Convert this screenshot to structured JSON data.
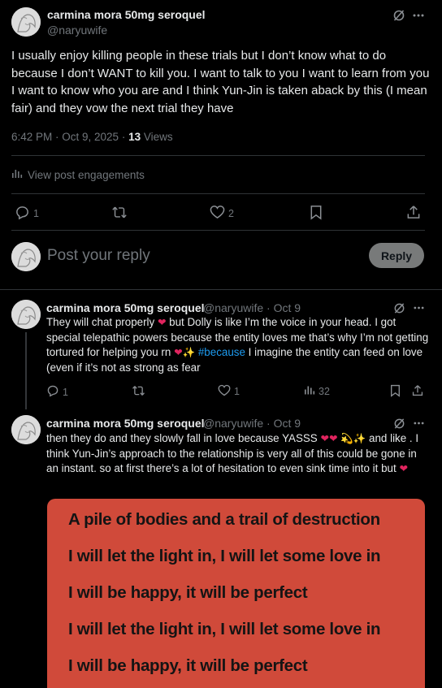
{
  "main_post": {
    "author_name": "carmina mora 50mg seroquel",
    "author_handle": "@naryuwife",
    "text": "I usually enjoy killing people in these trials but I don’t know what to do because I don’t WANT to kill you. I want to talk to you I want to learn from you I want to know who you are and I think Yun-Jin is taken aback by this (I mean fair) and they vow the next trial they have",
    "timestamp": "6:42 PM · Oct 9, 2025 · ",
    "views_count": "13",
    "views_label": " Views",
    "engagements_label": "View post engagements",
    "reply_count": "1",
    "like_count": "2"
  },
  "composer": {
    "placeholder": "Post your reply",
    "button_label": "Reply"
  },
  "replies": [
    {
      "author_name": "carmina mora 50mg seroquel",
      "author_handle": "@naryuwife",
      "date": " · Oct 9",
      "text_a": "They will chat properly ",
      "text_b": " but Dolly is like I’m the voice in your head. I got special telepathic powers because the entity loves me that’s why I’m not getting tortured for helping you rn ",
      "hashtag": "#because",
      "text_c": " I imagine the entity can feed on love (even if it’s not as strong as fear",
      "reply_count": "1",
      "like_count": "1",
      "view_count": "32"
    },
    {
      "author_name": "carmina mora 50mg seroquel",
      "author_handle": "@naryuwife",
      "date": " · Oct 9",
      "text_a": "then they do and they slowly fall in love because YASSS ",
      "text_b": " and like . I think Yun-Jin’s approach to the relationship is very all of this could be gone in an instant. so at first there’s a lot of hesitation to even sink time into it but "
    }
  ],
  "media_lyrics": [
    "A pile of bodies and a trail of destruction",
    "I will let the light in, I will let some love in",
    "I will be happy, it will be perfect",
    "I will let the light in, I will let some love in",
    "I will be happy, it will be perfect"
  ],
  "colors": {
    "background": "#000000",
    "text": "#e7e9ea",
    "muted": "#71767b",
    "link": "#1d9bf0",
    "media_bg": "#d04a3a",
    "heart_emoji": "#e0245e"
  },
  "icons": [
    "grok-icon",
    "more-icon",
    "reply-icon",
    "repost-icon",
    "like-icon",
    "bookmark-icon",
    "share-icon",
    "analytics-icon"
  ]
}
